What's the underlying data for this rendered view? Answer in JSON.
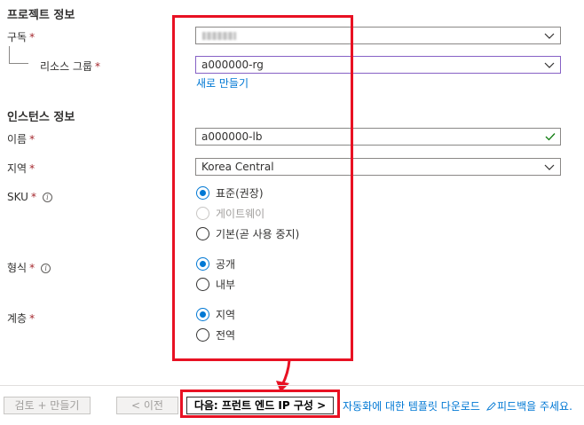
{
  "project": {
    "title": "프로젝트 정보",
    "subscription_label": "구독",
    "subscription_value": "",
    "resource_group_label": "리소스 그룹",
    "resource_group_value": "a000000-rg",
    "create_new_link": "새로 만들기"
  },
  "instance": {
    "title": "인스턴스 정보",
    "name_label": "이름",
    "name_value": "a000000-lb",
    "region_label": "지역",
    "region_value": "Korea Central",
    "sku_label": "SKU",
    "sku_options": [
      "표준(권장)",
      "게이트웨이",
      "기본(곧 사용 중지)"
    ],
    "type_label": "형식",
    "type_options": [
      "공개",
      "내부"
    ],
    "tier_label": "계층",
    "tier_options": [
      "지역",
      "전역"
    ]
  },
  "footer": {
    "review_create": "검토 + 만들기",
    "previous": "< 이전",
    "next": "다음: 프런트 엔드 IP 구성 >",
    "download_template": "자동화에 대한 템플릿 다운로드",
    "feedback": "피드백을 주세요."
  },
  "required_marker": "*",
  "colors": {
    "accent": "#0078d4",
    "highlight": "#e81123",
    "required": "#a4262c",
    "valid": "#107c10"
  }
}
